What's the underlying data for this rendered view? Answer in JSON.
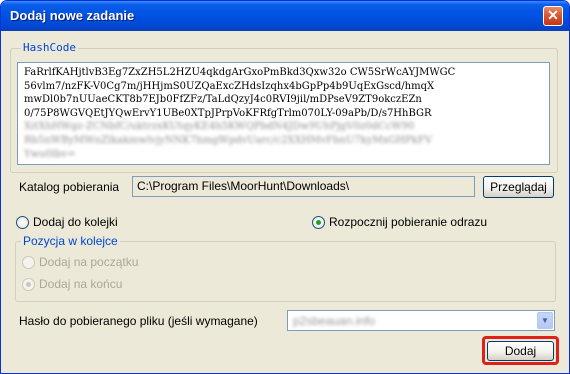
{
  "window": {
    "title": "Dodaj nowe zadanie",
    "close_glyph": "✕"
  },
  "hash": {
    "legend": "HashCode",
    "lines": [
      "FaRrlfKAHjtlvB3Eg7ZxZH5L2HZU4qkdgArGxoPmBkd3Qxw32o CW5SrWcAYJMWGC",
      "56vlm7/nzFK-V0Cg7m/jHHjmS0UZQaExcZHdsIzqhx4bGpPp4b9UqExGscd/hmqX",
      "mwDl0b7nUUaeCKT8b7EJb0FfZFz/TaLdQzyJ4c0RVI9jil/mDPseV9ZT9okczEZn",
      "0/75P8WGVQEtJYQwErvY1UBe0XTpJPrpVoKFRfgTrlm070LY-09aPb/D/s7HhBGR"
    ],
    "blurred_lines": [
      "XitXhHWgz-ZCNbfC/uktrzxKUtqyKE4h5KWQPbdN4JDw9UhPjgV0z0dCcW90",
      "Rb5nWByMWnZlkakmwlvjyNNK7hmgWpdvUarc/c2XXHMvFbnU7kyMxGHPkFV",
      "Ywu0lbv="
    ]
  },
  "download_folder": {
    "label": "Katalog pobierania",
    "value": "C:\\Program Files\\MoorHunt\\Downloads\\",
    "browse_label": "Przeglądaj"
  },
  "options": {
    "add_to_queue_label": "Dodaj do kolejki",
    "start_download_label": "Rozpocznij pobieranie odrazu",
    "selected": "start_download"
  },
  "queue_position": {
    "legend": "Pozycja w kolejce",
    "at_start_label": "Dodaj na początku",
    "at_end_label": "Dodaj na końcu",
    "selected": "at_end",
    "enabled": false
  },
  "password": {
    "label": "Hasło do pobieranego pliku (jeśli wymagane)",
    "value": "p2sbeauan.info"
  },
  "submit_label": "Dodaj",
  "colors": {
    "accent_title": "#0054e3",
    "legend": "#0046d5",
    "highlight": "#e0211a"
  }
}
